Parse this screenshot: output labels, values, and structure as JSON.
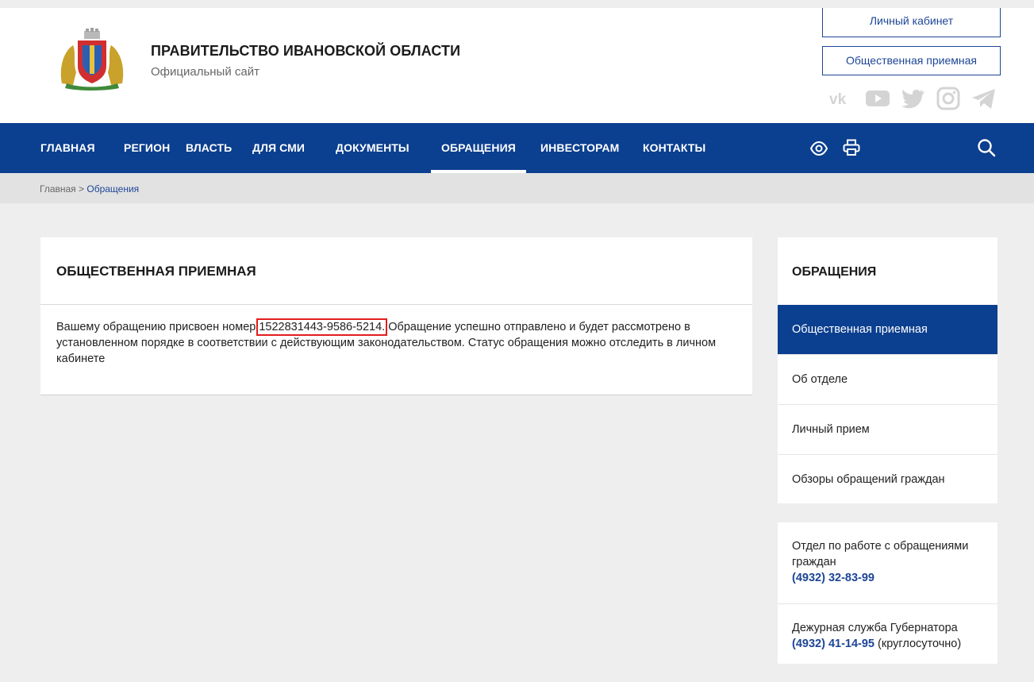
{
  "header": {
    "title": "ПРАВИТЕЛЬСТВО ИВАНОВСКОЙ ОБЛАСТИ",
    "subtitle": "Официальный сайт",
    "cabinet_label": "Личный кабинет",
    "reception_label": "Общественная приемная",
    "socials": [
      "vk-icon",
      "youtube-icon",
      "twitter-icon",
      "instagram-icon",
      "telegram-icon"
    ]
  },
  "nav": {
    "items": [
      "ГЛАВНАЯ",
      "РЕГИОН",
      "ВЛАСТЬ",
      "ДЛЯ СМИ",
      "ДОКУМЕНТЫ",
      "ОБРАЩЕНИЯ",
      "ИНВЕСТОРАМ",
      "КОНТАКТЫ"
    ],
    "active": "ОБРАЩЕНИЯ",
    "icons": [
      "eye-icon",
      "print-icon",
      "search-icon"
    ]
  },
  "breadcrumb": {
    "home": "Главная",
    "separator": " > ",
    "current": "Обращения"
  },
  "main": {
    "title": "ОБЩЕСТВЕННАЯ ПРИЕМНАЯ",
    "text_before": "Вашему обращению присвоен номер ",
    "number": "1522831443-9586-5214.",
    "text_after": " Обращение успешно отправлено и будет рассмотрено в установленном порядке в соответствии с действующим законодательством. Статус обращения можно отследить в личном кабинете"
  },
  "sidebar": {
    "title": "ОБРАЩЕНИЯ",
    "items": [
      {
        "label": "Общественная приемная",
        "active": true
      },
      {
        "label": "Об отделе",
        "active": false
      },
      {
        "label": "Личный прием",
        "active": false
      },
      {
        "label": "Обзоры обращений граждан",
        "active": false
      }
    ]
  },
  "contacts": {
    "dept_label": "Отдел по работе с обращениями граждан",
    "dept_phone": "(4932) 32-83-99",
    "duty_label": "Дежурная служба Губернатора",
    "duty_phone": "(4932) 41-14-95",
    "duty_note": " (круглосуточно)"
  },
  "colors": {
    "nav_bg": "#0b3f8f",
    "accent": "#1d4596",
    "highlight": "#e31d1d"
  }
}
